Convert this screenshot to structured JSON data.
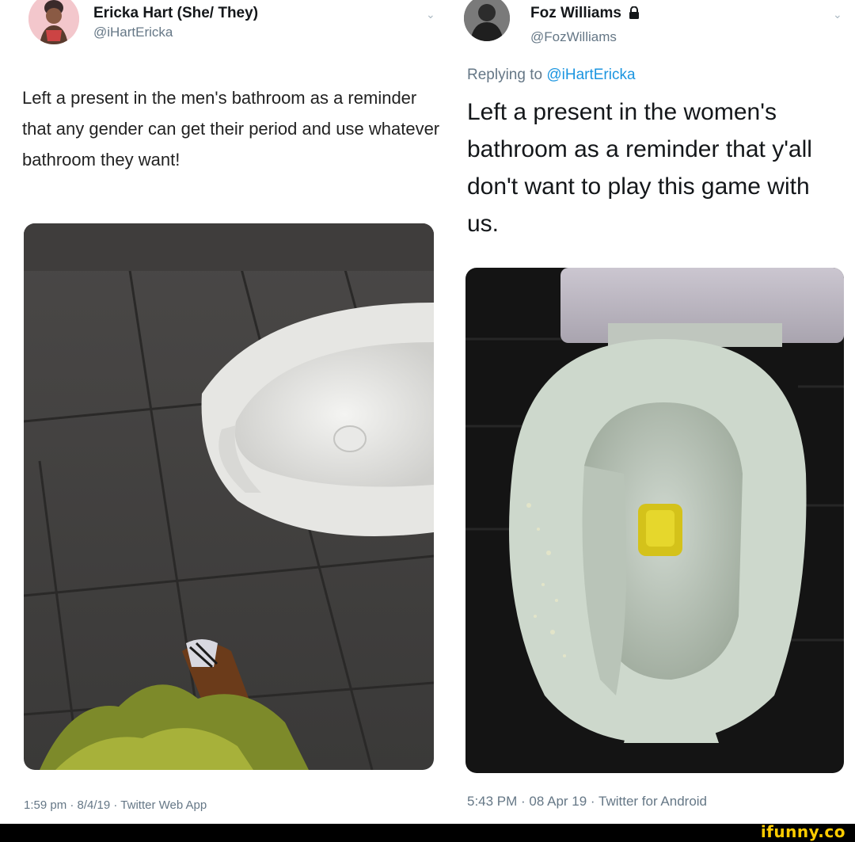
{
  "left_tweet": {
    "author_name": "Ericka Hart (She/ They)",
    "author_handle": "@iHartEricka",
    "text": "Left a present in the men's bathroom as a reminder that any gender can get their period and use whatever bathroom they want!",
    "timestamp": "1:59 pm · 8/4/19 · Twitter Web App",
    "avatar_icon": "avatar-illustration-icon",
    "menu_icon": "chevron-down-icon"
  },
  "right_tweet": {
    "author_name": "Foz Williams",
    "lock_icon": "lock-icon",
    "author_handle": "@FozWilliams",
    "replying_prefix": "Replying to",
    "replying_mention": "@iHartEricka",
    "text": "Left a present in the women's bathroom as a reminder that y'all don't want to play this game with us.",
    "timestamp": "5:43 PM · 08 Apr 19 · Twitter for Android",
    "menu_icon": "chevron-down-icon"
  },
  "watermark": "ifunny.co"
}
